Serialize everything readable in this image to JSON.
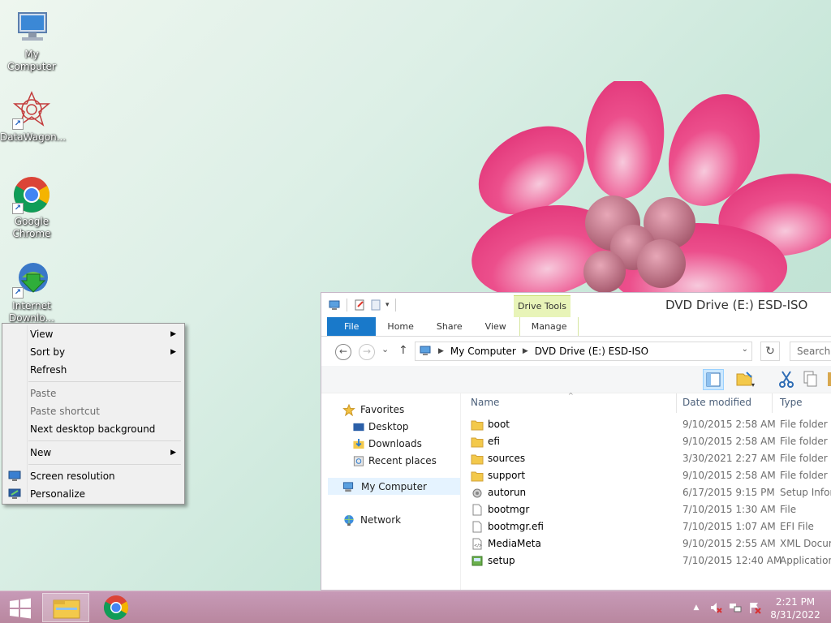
{
  "desktop": {
    "icons": [
      {
        "label": "My Computer"
      },
      {
        "label": "DataWagon..."
      },
      {
        "label": "Google Chrome"
      },
      {
        "label": "Internet Downlo..."
      }
    ]
  },
  "context_menu": {
    "items": [
      {
        "label": "View",
        "submenu": true
      },
      {
        "label": "Sort by",
        "submenu": true
      },
      {
        "label": "Refresh"
      },
      {
        "label": "Paste",
        "disabled": true
      },
      {
        "label": "Paste shortcut",
        "disabled": true
      },
      {
        "label": "Next desktop background"
      },
      {
        "label": "New",
        "submenu": true
      },
      {
        "label": "Screen resolution",
        "icon": "monitor-icon"
      },
      {
        "label": "Personalize",
        "icon": "personalize-icon"
      }
    ],
    "submenu_arrow": "▶"
  },
  "explorer": {
    "title": "DVD Drive (E:) ESD-ISO",
    "contextual_tab": "Drive Tools",
    "tabs": [
      "File",
      "Home",
      "Share",
      "View",
      "Manage"
    ],
    "address": {
      "crumbs": [
        "My Computer",
        "DVD Drive (E:) ESD-ISO"
      ],
      "separator": "▶",
      "dropdown": "⌄"
    },
    "search_placeholder": "Search D",
    "nav_back": "←",
    "nav_forward": "→",
    "nav_recent": "⌄",
    "nav_up": "↑",
    "refresh": "↻",
    "navigation": [
      {
        "label": "Favorites",
        "icon": "star-icon",
        "level": 0
      },
      {
        "label": "Desktop",
        "icon": "desktop-icon",
        "level": 1
      },
      {
        "label": "Downloads",
        "icon": "downloads-icon",
        "level": 1
      },
      {
        "label": "Recent places",
        "icon": "recent-places-icon",
        "level": 1
      },
      {
        "label": "My Computer",
        "icon": "computer-icon",
        "level": 0,
        "selected": true
      },
      {
        "label": "Network",
        "icon": "network-icon",
        "level": 0
      }
    ],
    "columns": [
      "Name",
      "Date modified",
      "Type"
    ],
    "sort_indicator": "^",
    "files": [
      {
        "name": "boot",
        "date": "9/10/2015 2:58 AM",
        "type": "File folder",
        "icon": "folder-icon"
      },
      {
        "name": "efi",
        "date": "9/10/2015 2:58 AM",
        "type": "File folder",
        "icon": "folder-icon"
      },
      {
        "name": "sources",
        "date": "3/30/2021 2:27 AM",
        "type": "File folder",
        "icon": "folder-icon"
      },
      {
        "name": "support",
        "date": "9/10/2015 2:58 AM",
        "type": "File folder",
        "icon": "folder-icon"
      },
      {
        "name": "autorun",
        "date": "6/17/2015 9:15 PM",
        "type": "Setup Inform",
        "icon": "setup-info-icon"
      },
      {
        "name": "bootmgr",
        "date": "7/10/2015 1:30 AM",
        "type": "File",
        "icon": "file-icon"
      },
      {
        "name": "bootmgr.efi",
        "date": "7/10/2015 1:07 AM",
        "type": "EFI File",
        "icon": "file-icon"
      },
      {
        "name": "MediaMeta",
        "date": "9/10/2015 2:55 AM",
        "type": "XML Docum",
        "icon": "xml-icon"
      },
      {
        "name": "setup",
        "date": "7/10/2015 12:40 AM",
        "type": "Application",
        "icon": "setup-app-icon"
      }
    ]
  },
  "taskbar": {
    "time": "2:21 PM",
    "date": "8/31/2022",
    "tray_expand": "▲"
  },
  "colors": {
    "file_tab": "#1979ca",
    "drive_tools": "#e8f4b8",
    "taskbar": "#c79ab7",
    "flower": "#e8407f"
  }
}
